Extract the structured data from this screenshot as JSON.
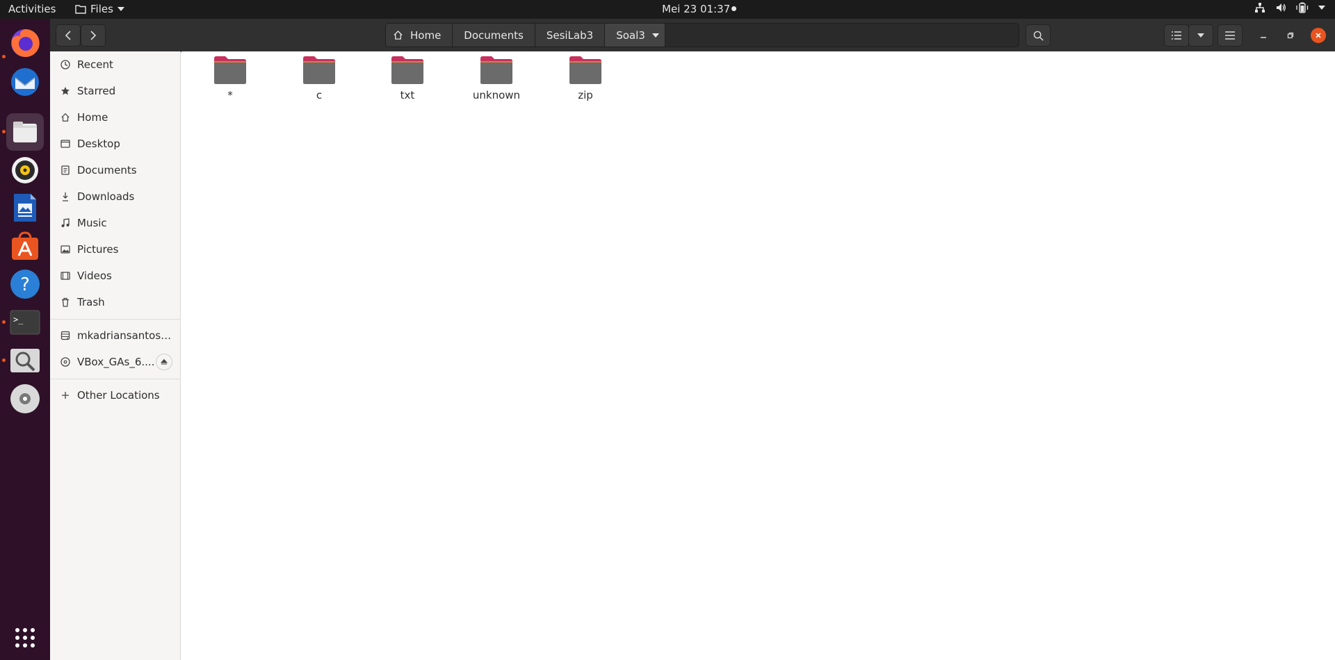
{
  "topbar": {
    "activities": "Activities",
    "app_menu": "Files",
    "clock": "Mei 23  01:37"
  },
  "dock": {
    "items": [
      {
        "name": "firefox-icon"
      },
      {
        "name": "thunderbird-icon"
      },
      {
        "name": "files-icon"
      },
      {
        "name": "rhythmbox-icon"
      },
      {
        "name": "libreoffice-writer-icon"
      },
      {
        "name": "software-center-icon"
      },
      {
        "name": "help-icon"
      },
      {
        "name": "terminal-icon"
      },
      {
        "name": "screenshot-icon"
      },
      {
        "name": "dvd-icon"
      },
      {
        "name": "show-apps-icon"
      }
    ]
  },
  "pathbar": {
    "crumbs": [
      "Home",
      "Documents",
      "SesiLab3",
      "Soal3"
    ]
  },
  "sidebar": {
    "items": [
      {
        "label": "Recent",
        "icon": "clock-icon"
      },
      {
        "label": "Starred",
        "icon": "star-icon"
      },
      {
        "label": "Home",
        "icon": "home-icon"
      },
      {
        "label": "Desktop",
        "icon": "desktop-icon"
      },
      {
        "label": "Documents",
        "icon": "document-icon"
      },
      {
        "label": "Downloads",
        "icon": "download-icon"
      },
      {
        "label": "Music",
        "icon": "music-icon"
      },
      {
        "label": "Pictures",
        "icon": "picture-icon"
      },
      {
        "label": "Videos",
        "icon": "video-icon"
      },
      {
        "label": "Trash",
        "icon": "trash-icon"
      }
    ],
    "devices": [
      {
        "label": "mkadriansantoso...",
        "icon": "drive-icon"
      },
      {
        "label": "VBox_GAs_6....",
        "icon": "disc-icon"
      }
    ],
    "other_locations": "Other Locations"
  },
  "files": [
    {
      "name": "*"
    },
    {
      "name": "c"
    },
    {
      "name": "txt"
    },
    {
      "name": "unknown"
    },
    {
      "name": "zip"
    }
  ],
  "colors": {
    "accent": "#e95420",
    "folder_body": "#6b6b6b",
    "folder_tab": "#c7315c"
  }
}
